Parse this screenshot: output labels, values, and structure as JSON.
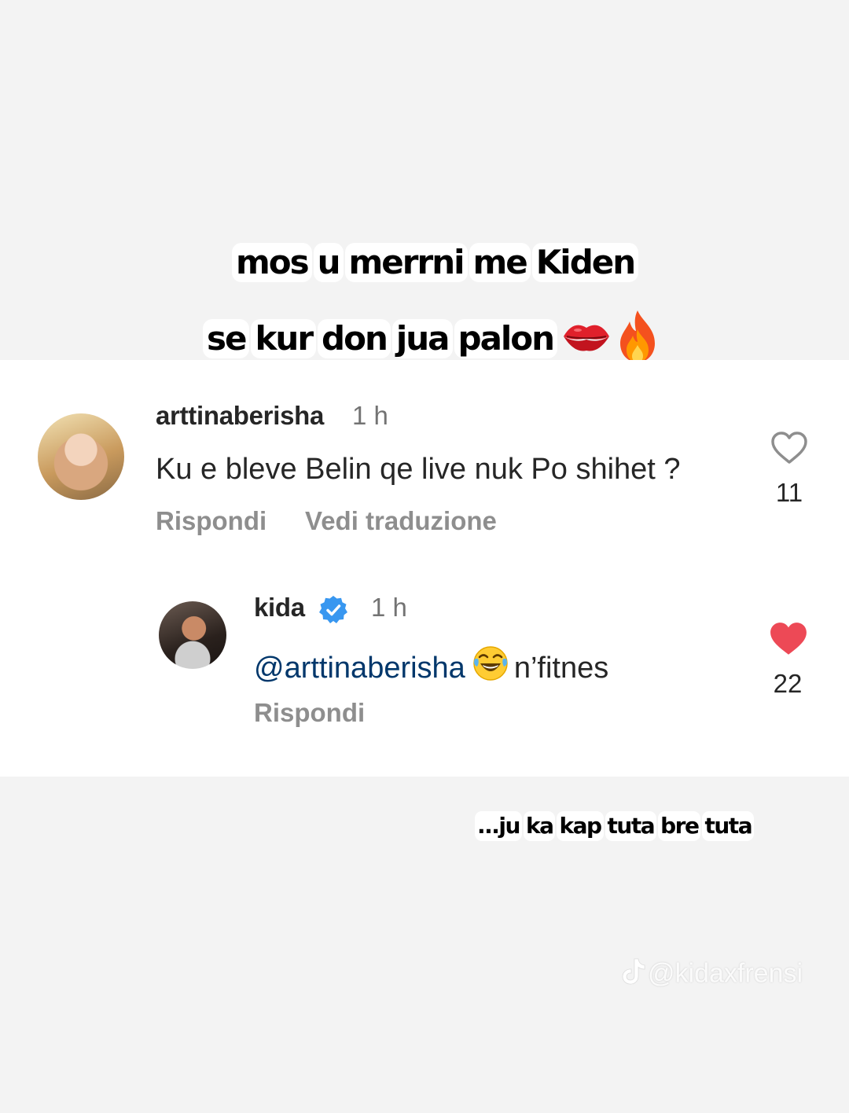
{
  "captions": {
    "top_line_1": [
      "mos",
      "u",
      "merrni",
      "me",
      "Kiden"
    ],
    "top_line_2": [
      "se",
      "kur",
      "don",
      "jua",
      "palon"
    ],
    "top_line_2_emojis": [
      "kiss-lips-emoji",
      "fire-emoji"
    ],
    "bottom_line": [
      "...ju",
      "ka",
      "kap",
      "tuta",
      "bre",
      "tuta"
    ]
  },
  "comments": [
    {
      "username": "arttinaberisha",
      "time": "1 h",
      "text": "Ku e bleve Belin qe live nuk Po shihet ?",
      "like_count": "11",
      "liked": false,
      "reply_label": "Rispondi",
      "translate_label": "Vedi traduzione"
    }
  ],
  "reply": {
    "username": "kida",
    "verified": true,
    "time": "1 h",
    "mention": "@arttinaberisha",
    "emoji": "face-with-tears-of-joy-emoji",
    "text": "n’fitnes",
    "like_count": "22",
    "liked": true,
    "reply_label": "Rispondi"
  },
  "watermark": {
    "handle": "@kidaxfrensi",
    "icon": "tiktok-icon"
  },
  "colors": {
    "background": "#f3f3f3",
    "panel": "#ffffff",
    "liked_heart": "#ed4956",
    "verified_badge": "#3897f0",
    "mention": "#00376b"
  }
}
